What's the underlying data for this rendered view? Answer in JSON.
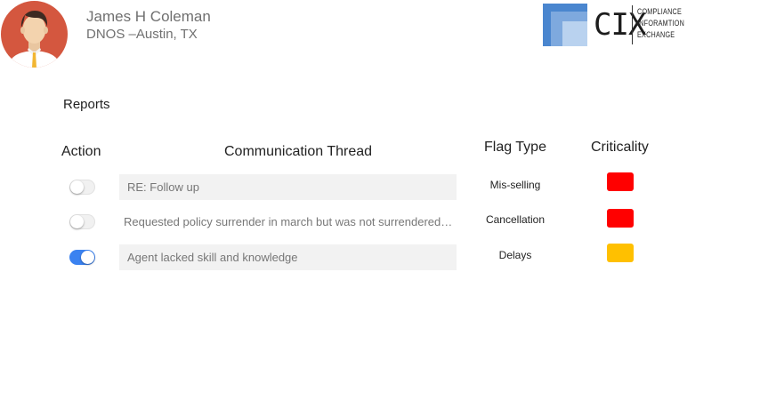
{
  "user": {
    "name": "James H Coleman",
    "location": "DNOS –Austin, TX",
    "avatar_icon": "person-avatar-icon"
  },
  "brand": {
    "logo_text": "CIX",
    "logo_subtitle": [
      "COMPLIANCE",
      "INFORAMTION",
      "EXCHANGE"
    ],
    "logo_colors": {
      "light": "#b9d2ef",
      "mid": "#7ea9de",
      "dark": "#4a86cf"
    }
  },
  "reports": {
    "title": "Reports",
    "columns": {
      "action": "Action",
      "thread": "Communication Thread",
      "flag_type": "Flag Type",
      "criticality": "Criticality"
    },
    "rows": [
      {
        "action_enabled": false,
        "thread": "RE: Follow up",
        "flag_type": "Mis-selling",
        "criticality": "high",
        "criticality_color": "#ff0000"
      },
      {
        "action_enabled": false,
        "thread": "Requested policy surrender in march but was not surrendered…",
        "flag_type": "Cancellation",
        "criticality": "high",
        "criticality_color": "#ff0000"
      },
      {
        "action_enabled": true,
        "thread": "Agent lacked skill and knowledge",
        "flag_type": "Delays",
        "criticality": "medium",
        "criticality_color": "#ffc000"
      }
    ]
  },
  "colors": {
    "toggle_on": "#3b82f0",
    "thread_background": "#f2f2f2"
  }
}
